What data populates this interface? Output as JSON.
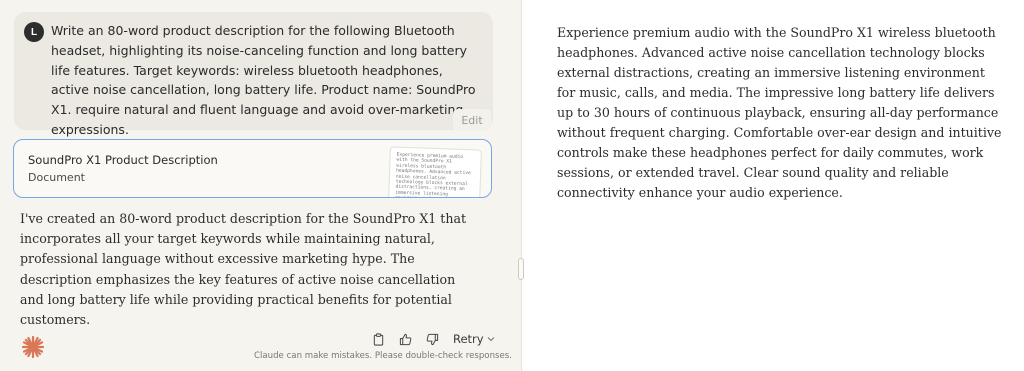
{
  "user": {
    "avatar_initial": "L",
    "message": "Write an 80-word product description for the following Bluetooth headset, highlighting its noise-canceling function and long battery life features. Target keywords: wireless bluetooth headphones, active noise cancellation, long battery life. Product name: SoundPro X1. require natural and fluent language and avoid over-marketing expressions.",
    "edit_label": "Edit"
  },
  "artifact_card": {
    "title": "SoundPro X1 Product Description",
    "type": "Document",
    "thumbnail_text": "Experience premium audio with the SoundPro X1 wireless bluetooth headphones. Advanced active noise cancellation technology blocks external distractions, creating an immersive listening environment for music, calls, and media. The impressive long batt"
  },
  "assistant": {
    "message": "I've created an 80-word product description for the SoundPro X1 that incorporates all your target keywords while maintaining natural, professional language without excessive marketing hype. The description emphasizes the key features of active noise cancellation and long battery life while providing practical benefits for potential customers.",
    "retry_label": "Retry",
    "disclaimer": "Claude can make mistakes. Please double-check responses."
  },
  "artifact": {
    "content": "Experience premium audio with the SoundPro X1 wireless bluetooth headphones. Advanced active noise cancellation technology blocks external distractions, creating an immersive listening environment for music, calls, and media. The impressive long battery life delivers up to 30 hours of continuous playback, ensuring all-day performance without frequent charging. Comfortable over-ear design and intuitive controls make these headphones perfect for daily commutes, work sessions, or extended travel. Clear sound quality and reliable connectivity enhance your audio experience."
  },
  "icons": {
    "copy": "clipboard-icon",
    "like": "thumbs-up-icon",
    "dislike": "thumbs-down-icon",
    "retry_menu": "chevron-down-icon",
    "logo": "claude-sparkle-icon"
  },
  "colors": {
    "chat_background": "#f5f4ef",
    "user_bubble": "#ebe9e2",
    "card_border": "#77a6e6",
    "logo": "#d97757"
  }
}
